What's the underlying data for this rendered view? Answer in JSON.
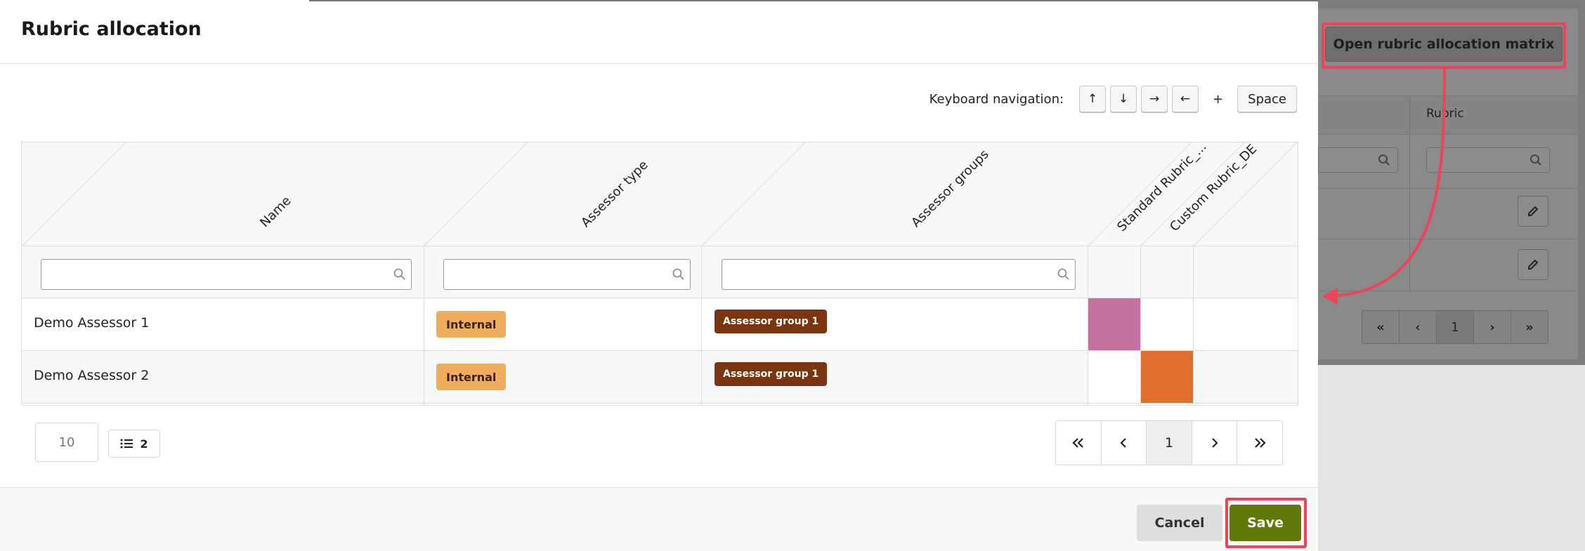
{
  "modal": {
    "title": "Rubric allocation",
    "keyboard": {
      "label": "Keyboard navigation:",
      "keys": [
        "↑",
        "↓",
        "→",
        "←"
      ],
      "plus": "+",
      "space": "Space"
    },
    "table": {
      "columns": [
        "Name",
        "Assessor type",
        "Assessor groups",
        "Standard Rubric_...",
        "Custom Rubric_DE"
      ],
      "rows": [
        {
          "name": "Demo Assessor 1",
          "assessor_type": "Internal",
          "assessor_group": "Assessor group 1",
          "allocation_color": "#c3719e"
        },
        {
          "name": "Demo Assessor 2",
          "assessor_type": "Internal",
          "assessor_group": "Assessor group 1",
          "allocation_color": "#e06e2e"
        }
      ]
    },
    "pagination": {
      "page_size": "10",
      "row_count": "2",
      "current_page": "1"
    },
    "footer": {
      "cancel": "Cancel",
      "save": "Save"
    }
  },
  "background": {
    "open_button": "Open rubric allocation matrix",
    "rubric_header": "Rubric",
    "pager_page": "1"
  },
  "colors": {
    "save": "#5f7a0a",
    "internal_badge": "#f0ad5e",
    "group_badge": "#7b3410",
    "annotation": "#ee4455"
  }
}
